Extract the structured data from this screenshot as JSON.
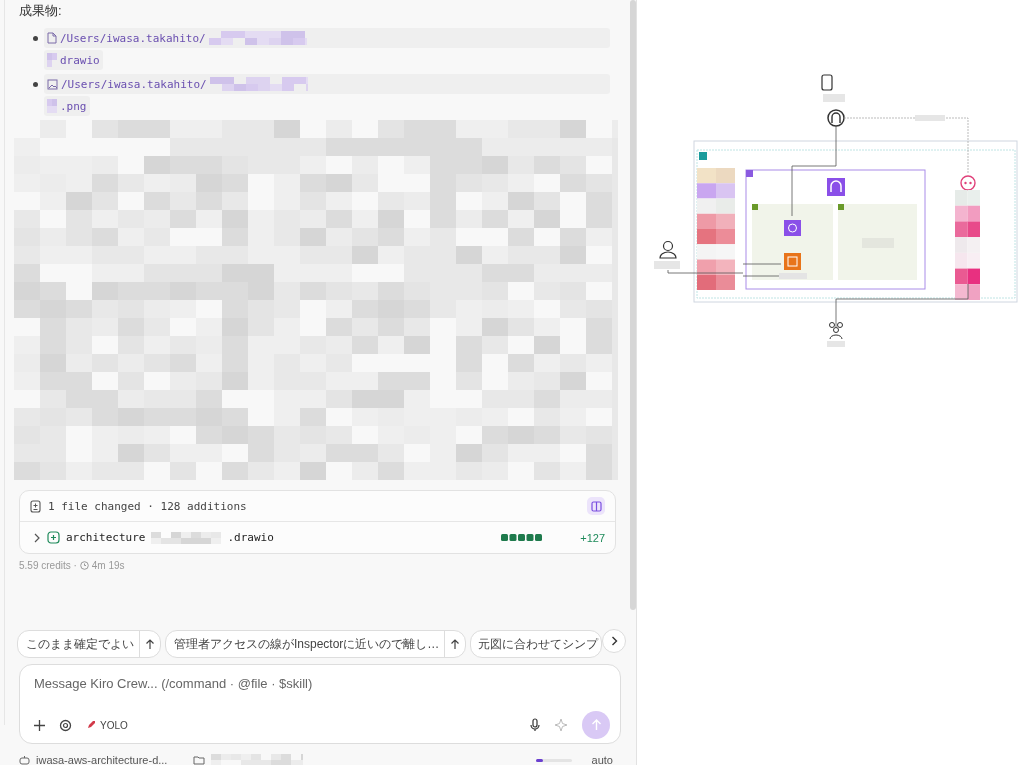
{
  "deliverables": {
    "heading": "成果物:",
    "items": [
      {
        "kind": "file",
        "path": "/Users/iwasa.takahito/",
        "tail": "drawio"
      },
      {
        "kind": "image",
        "path": "/Users/iwasa.takahito/",
        "tail": ".png"
      }
    ]
  },
  "changes": {
    "summary": "1 file changed · 128 additions",
    "files": [
      {
        "expanded": false,
        "name_start": "architecture",
        "name_end": ".drawio",
        "added": "+127"
      }
    ]
  },
  "meta": {
    "credits": "5.59 credits ·",
    "duration": "4m 19s"
  },
  "suggestions": [
    {
      "text": "このまま確定でよい"
    },
    {
      "text": "管理者アクセスの線がInspectorに近いので離し…"
    },
    {
      "text": "元図に合わせてシンプ"
    }
  ],
  "composer": {
    "placeholder": "Message Kiro Crew... (/command · @file · $skill)",
    "mode": "YOLO"
  },
  "footer": {
    "agent": "iwasa-aws-architecture-d...",
    "context_meter": {
      "level": 0.2
    },
    "model": "auto"
  }
}
